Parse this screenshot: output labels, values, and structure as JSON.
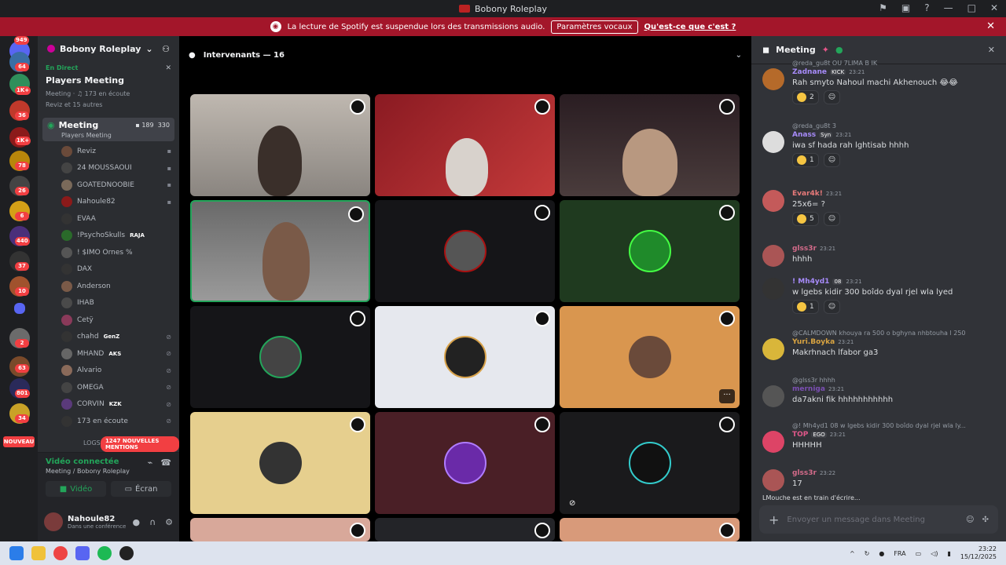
{
  "window": {
    "title": "Bobony Roleplay"
  },
  "banner": {
    "text": "La lecture de Spotify est suspendue lors des transmissions audio.",
    "button": "Paramètres vocaux",
    "link": "Qu'est-ce que c'est ?"
  },
  "guilds": {
    "badges": [
      "949",
      "64",
      "1K+",
      "36",
      "1K+",
      "78",
      "26",
      "6",
      "440",
      "37",
      "10",
      "2",
      "63",
      "801",
      "34"
    ],
    "new_label": "NOUVEAU"
  },
  "server": {
    "name": "Bobony Roleplay"
  },
  "live": {
    "label": "En Direct",
    "title": "Players Meeting",
    "sub": "Meeting",
    "listening": "173 en écoute",
    "others": "Reviz et 15 autres"
  },
  "active_channel": {
    "name": "Meeting",
    "video_count": "189",
    "count": "330",
    "sub": "Players Meeting"
  },
  "members": [
    {
      "name": "Reviz",
      "tag": ""
    },
    {
      "name": "24 MOUSSAOUI",
      "tag": ""
    },
    {
      "name": "GOATEDNOOBIE",
      "tag": ""
    },
    {
      "name": "Nahoule82",
      "tag": ""
    },
    {
      "name": "EVAA",
      "tag": ""
    },
    {
      "name": "!PsychoSkulls",
      "tag": "RAJA"
    },
    {
      "name": "! $IMO Ornes %",
      "tag": ""
    },
    {
      "name": "DAX",
      "tag": ""
    },
    {
      "name": "Anderson",
      "tag": ""
    },
    {
      "name": "IHAB",
      "tag": ""
    },
    {
      "name": "Cetÿ",
      "tag": ""
    },
    {
      "name": "chahd",
      "tag": "GenZ"
    },
    {
      "name": "MHAND",
      "tag": "AKS"
    },
    {
      "name": "Alvario",
      "tag": ""
    },
    {
      "name": "OMEGA",
      "tag": ""
    },
    {
      "name": "CORVIN",
      "tag": "KZK"
    },
    {
      "name": "173 en écoute",
      "tag": ""
    }
  ],
  "logs_label": "LOGS",
  "mentions": "1247 NOUVELLES MENTIONS",
  "voice": {
    "status": "Vidéo connectée",
    "where": "Meeting / Bobony Roleplay",
    "video_btn": "Vidéo",
    "screen_btn": "Écran"
  },
  "user": {
    "name": "Nahoule82",
    "status": "Dans une conférence"
  },
  "stage": {
    "header": "Intervenants — 16"
  },
  "chat": {
    "title": "Meeting",
    "messages": [
      {
        "reply": "@reda_gu8t OU 7LIMA B IK",
        "name": "Zadnane",
        "tag": "KICK",
        "time": "23:21",
        "text": "Rah smyto Nahoul machi Akhenouch 😂😂",
        "react": "2",
        "color": "#a78bfa"
      },
      {
        "reply": "@reda_gu8t 3",
        "name": "Anass",
        "tag": "Syn",
        "time": "23:21",
        "text": "iwa sf hada rah lghtisab hhhh",
        "react": "1",
        "color": "#a78bfa"
      },
      {
        "reply": "",
        "name": "Evar4k!",
        "tag": "",
        "time": "23:21",
        "text": "25x6= ?",
        "react": "5",
        "color": "#e87a7a"
      },
      {
        "reply": "",
        "name": "glss3r",
        "tag": "",
        "time": "23:21",
        "text": "hhhh",
        "react": "",
        "color": "#d46b8a"
      },
      {
        "reply": "",
        "name": "! Mh4yd1",
        "tag": "08",
        "time": "23:21",
        "text": "w lgebs kidir 300 boîdo dyal rjel wla lyed",
        "react": "1",
        "color": "#a78bfa"
      },
      {
        "reply": "@CALMDOWN khouya ra 500 o bghyna nhbtouha l 250",
        "name": "Yuri.Boyka",
        "tag": "",
        "time": "23:21",
        "text": "Makrhnach lfabor ga3",
        "react": "",
        "color": "#d9a441"
      },
      {
        "reply": "@glss3r hhhh",
        "name": "merniga",
        "tag": "",
        "time": "23:21",
        "text": "da7akni fik hhhhhhhhhhh",
        "react": "",
        "color": "#7b4fb3"
      },
      {
        "reply": "@! Mh4yd1 08 w lgebs kidir 300 boîdo dyal rjel wla ly...",
        "name": "TOP",
        "tag": "EGO",
        "time": "23:21",
        "text": "HHHHH",
        "react": "",
        "color": "#e0588a"
      },
      {
        "reply": "",
        "name": "glss3r",
        "tag": "",
        "time": "23:22",
        "text": "17",
        "react": "",
        "color": "#d46b8a"
      }
    ],
    "typing": "LMouche est en train d'écrire...",
    "placeholder": "Envoyer un message dans Meeting"
  },
  "taskbar": {
    "lang": "FRA",
    "time": "23:22",
    "date": "15/12/2025"
  }
}
